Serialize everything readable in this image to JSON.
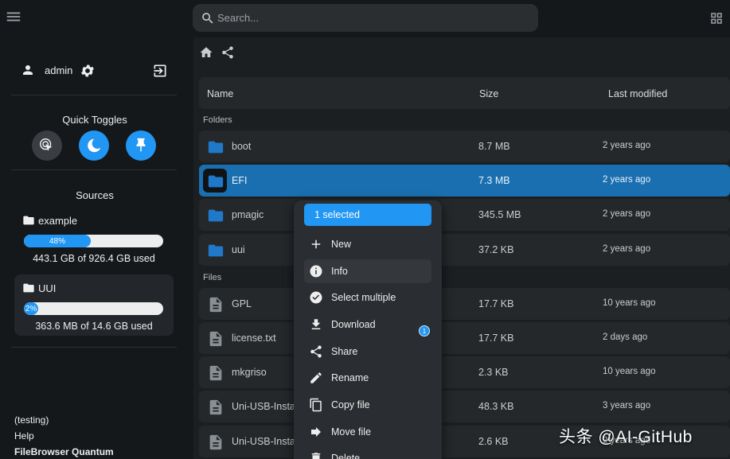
{
  "search": {
    "placeholder": "Search..."
  },
  "user": {
    "name": "admin"
  },
  "quick_toggles": {
    "title": "Quick Toggles"
  },
  "sources": {
    "title": "Sources",
    "items": [
      {
        "name": "example",
        "percent": "48%",
        "fill": 0.48,
        "usage": "443.1 GB of 926.4 GB used"
      },
      {
        "name": "UUI",
        "percent": "2%",
        "fill": 0.02,
        "usage": "363.6 MB of 14.6 GB used"
      }
    ]
  },
  "footer": {
    "testing": "(testing)",
    "help": "Help",
    "app_name": "FileBrowser Quantum"
  },
  "table": {
    "col_name": "Name",
    "col_size": "Size",
    "col_modified": "Last modified"
  },
  "sections": {
    "folders": "Folders",
    "files": "Files"
  },
  "folders": [
    {
      "name": "boot",
      "size": "8.7 MB",
      "modified": "2 years ago"
    },
    {
      "name": "EFI",
      "size": "7.3 MB",
      "modified": "2 years ago"
    },
    {
      "name": "pmagic",
      "size": "345.5 MB",
      "modified": "2 years ago"
    },
    {
      "name": "uui",
      "size": "37.2 KB",
      "modified": "2 years ago"
    }
  ],
  "files": [
    {
      "name": "GPL",
      "size": "17.7 KB",
      "modified": "10 years ago"
    },
    {
      "name": "license.txt",
      "size": "17.7 KB",
      "modified": "2 days ago"
    },
    {
      "name": "mkgriso",
      "size": "2.3 KB",
      "modified": "10 years ago"
    },
    {
      "name": "Uni-USB-Instal",
      "size": "48.3 KB",
      "modified": "3 years ago"
    },
    {
      "name": "Uni-USB-Instal",
      "size": "2.6 KB",
      "modified": "2 years ago"
    }
  ],
  "context_menu": {
    "selected": "1 selected",
    "new": "New",
    "info": "Info",
    "select_multiple": "Select multiple",
    "download": "Download",
    "download_count": "1",
    "share": "Share",
    "rename": "Rename",
    "copy_file": "Copy file",
    "move_file": "Move file",
    "delete": "Delete"
  },
  "watermark": "头条 @AI-GitHub",
  "colors": {
    "accent": "#2196f3",
    "selected_row": "#1a6fb0",
    "folder": "#1f78c8"
  }
}
